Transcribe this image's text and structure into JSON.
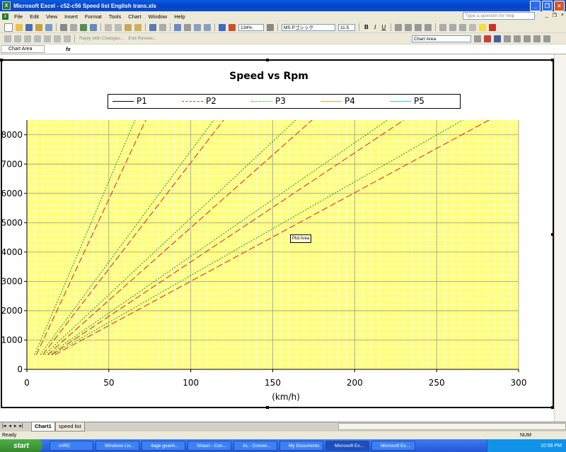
{
  "window": {
    "title": "Microsoft Excel - c52-c56 Speed list English trans.xls"
  },
  "menu": [
    "File",
    "Edit",
    "View",
    "Insert",
    "Format",
    "Tools",
    "Chart",
    "Window",
    "Help"
  ],
  "help_placeholder": "Type a question for help",
  "toolbar": {
    "zoom": "134%",
    "font_name": "MS Pゴシック",
    "font_size": "11.5",
    "reply_text": "Reply with Changes...",
    "end_review": "End Review...",
    "chart_object": "Chart Area"
  },
  "namebox": "Chart Area",
  "fx": "fx",
  "tooltip": "Plot Area",
  "sheets": [
    "Chart1",
    "speed list"
  ],
  "status": {
    "left": "Ready",
    "num": "NUM"
  },
  "taskbar": {
    "start": "start",
    "items": [
      "mIRC",
      "Windows Liv...",
      "4age gearin...",
      "Shaun - Con...",
      "AL - Conver...",
      "My Documents",
      "Microsoft Ex...",
      "Microsoft Ex..."
    ],
    "clock": "10:58 PM"
  },
  "chart_data": {
    "type": "line",
    "title": "Speed vs Rpm",
    "xlabel": "(km/h)",
    "ylabel": "",
    "xlim": [
      0,
      300
    ],
    "ylim": [
      0,
      8500
    ],
    "xticks": [
      0,
      50,
      100,
      150,
      200,
      250,
      300
    ],
    "yticks": [
      0,
      1000,
      2000,
      3000,
      4000,
      5000,
      6000,
      7000,
      8000
    ],
    "background": "#ffff80",
    "legend_position": "top",
    "series": [
      {
        "name": "P1",
        "color": "#000000",
        "dash": "solid",
        "lines": []
      },
      {
        "name": "P2",
        "color": "#e03030",
        "dash": "long-dash",
        "lines": [
          {
            "x": [
              5.8,
              72.5
            ],
            "y": [
              500,
              8500
            ]
          },
          {
            "x": [
              9.7,
              120
            ],
            "y": [
              500,
              8500
            ]
          },
          {
            "x": [
              12.6,
              174
            ],
            "y": [
              500,
              8500
            ]
          },
          {
            "x": [
              14.9,
              230
            ],
            "y": [
              500,
              8500
            ]
          },
          {
            "x": [
              17.1,
              282
            ],
            "y": [
              500,
              8500
            ]
          }
        ]
      },
      {
        "name": "P3",
        "color": "#2f9a2f",
        "dash": "dotted",
        "lines": [
          {
            "x": [
              4.7,
              66
            ],
            "y": [
              500,
              8500
            ]
          },
          {
            "x": [
              8.2,
              114
            ],
            "y": [
              500,
              8500
            ]
          },
          {
            "x": [
              10.8,
              164
            ],
            "y": [
              500,
              8500
            ]
          },
          {
            "x": [
              13.3,
              220
            ],
            "y": [
              500,
              8500
            ]
          },
          {
            "x": [
              15.4,
              266
            ],
            "y": [
              500,
              8500
            ]
          }
        ]
      },
      {
        "name": "P4",
        "color": "#f0a030",
        "dash": "solid",
        "lines": []
      },
      {
        "name": "P5",
        "color": "#40c8e0",
        "dash": "solid",
        "lines": []
      }
    ]
  }
}
